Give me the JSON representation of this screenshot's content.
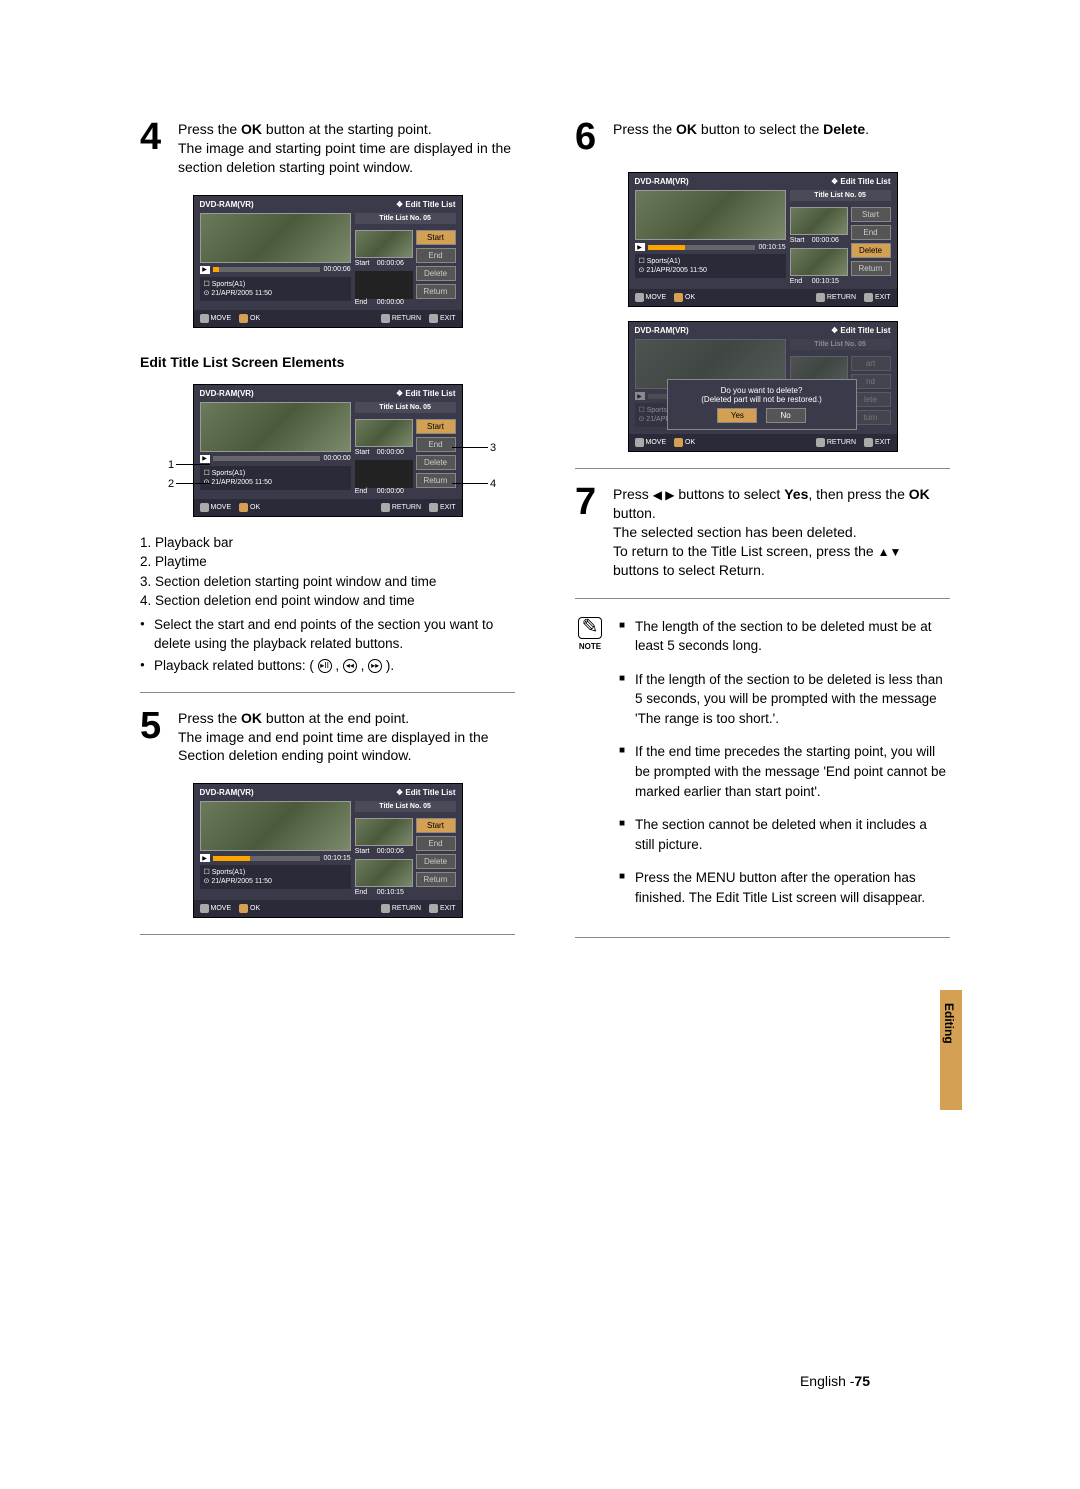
{
  "left": {
    "step4": {
      "num": "4",
      "line1a": "Press the ",
      "line1b": "OK",
      "line1c": " button at the starting point.",
      "line2": "The image and starting point time are displayed in the section deletion starting point window."
    },
    "screen_common": {
      "header_l": "DVD-RAM(VR)",
      "header_r": "Edit Title List",
      "title_no": "Title List No. 05",
      "sports": "Sports(A1)",
      "date": "21/APR/2005 11:50",
      "move": "MOVE",
      "ok": "OK",
      "return": "RETURN",
      "exit": "EXIT",
      "btn_start": "Start",
      "btn_end": "End",
      "btn_delete": "Delete",
      "btn_return": "Return",
      "lbl_start": "Start",
      "lbl_end": "End"
    },
    "screen4": {
      "playtime": "00:00:06",
      "start_t": "00:00:06",
      "end_t": "00:00:00"
    },
    "subhead": "Edit Title List Screen Elements",
    "screenE": {
      "playtime": "00:00:00",
      "start_t": "00:00:00",
      "end_t": "00:00:00"
    },
    "annot": {
      "n1": "1",
      "n2": "2",
      "n3": "3",
      "n4": "4"
    },
    "legend": {
      "l1": "1. Playback bar",
      "l2": "2. Playtime",
      "l3": "3. Section deletion starting point window and time",
      "l4": "4. Section deletion end point window and time",
      "b1": "Select the start and end points of the section you want to delete using the playback related buttons.",
      "b2": "Playback related buttons: (           ,           ,           )."
    },
    "step5": {
      "num": "5",
      "line1a": "Press the ",
      "line1b": "OK",
      "line1c": " button at the end point.",
      "line2": "The image and end point time are displayed in the Section deletion ending point window."
    },
    "screen5": {
      "playtime": "00:10:15",
      "start_t": "00:00:06",
      "end_t": "00:10:15"
    }
  },
  "right": {
    "step6": {
      "num": "6",
      "line1a": "Press the ",
      "line1b": "OK",
      "line1c": " button to select the ",
      "line1d": "Delete",
      "line1e": "."
    },
    "screen6": {
      "playtime": "00:10:15",
      "start_t": "00:00:06",
      "end_t": "00:10:15"
    },
    "dialog": {
      "l1": "Do you want to delete?",
      "l2": "(Deleted part will not be restored.)",
      "yes": "Yes",
      "no": "No"
    },
    "step7": {
      "num": "7",
      "line1a": "Press ",
      "line1b": " buttons to select ",
      "line1c": "Yes",
      "line1d": ", then press the ",
      "line1e": "OK",
      "line1f": " button.",
      "line2": "The selected section has been deleted.",
      "line3a": "To return to the Title List screen, press the ",
      "line3b": " buttons to select Return."
    },
    "note_label": "NOTE",
    "notes": {
      "n1": "The length of the section to be deleted must be at least 5 seconds long.",
      "n2": "If the length of the section to be deleted is less than 5 seconds, you will be prompted with the message 'The range is too short.'.",
      "n3": "If the end time precedes the starting point, you will be prompted with the message 'End point cannot be marked earlier than start point'.",
      "n4": "The section cannot be deleted when it includes a still picture.",
      "n5": "Press the MENU button after the operation has finished. The Edit Title List screen will disappear."
    }
  },
  "tab": "Editing",
  "footer": {
    "lang": "English -",
    "page": "75"
  }
}
